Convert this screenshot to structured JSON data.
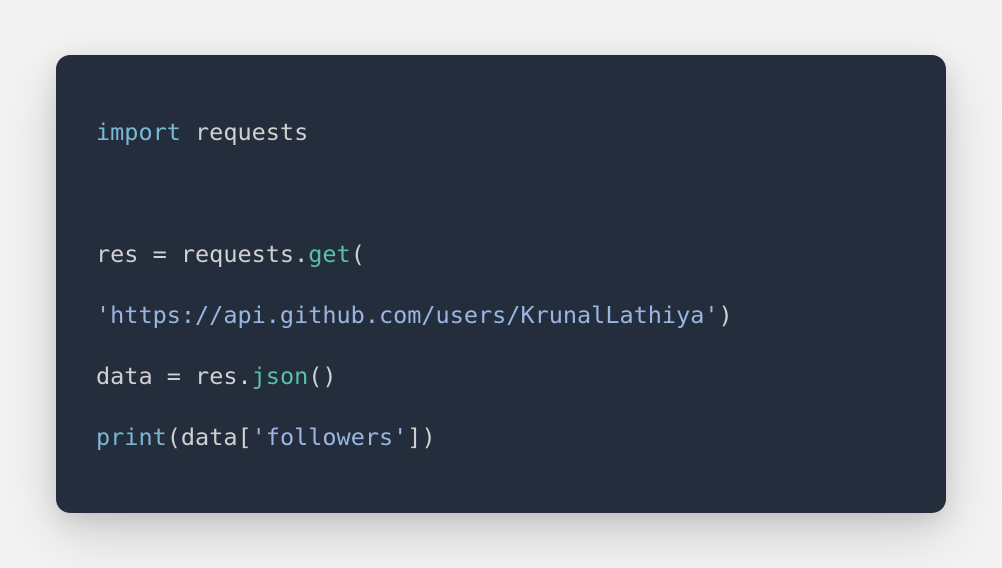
{
  "code": {
    "tokens": [
      [
        {
          "cls": "tok-keyword",
          "t": "import"
        },
        {
          "cls": "tok-default",
          "t": " requests"
        }
      ],
      [],
      [
        {
          "cls": "tok-default",
          "t": "res "
        },
        {
          "cls": "tok-punct",
          "t": "= "
        },
        {
          "cls": "tok-default",
          "t": "requests"
        },
        {
          "cls": "tok-punct",
          "t": "."
        },
        {
          "cls": "tok-method",
          "t": "get"
        },
        {
          "cls": "tok-punct",
          "t": "("
        }
      ],
      [
        {
          "cls": "tok-string",
          "t": "'https://api.github.com/users/KrunalLathiya'"
        },
        {
          "cls": "tok-punct",
          "t": ")"
        }
      ],
      [
        {
          "cls": "tok-default",
          "t": "data "
        },
        {
          "cls": "tok-punct",
          "t": "= "
        },
        {
          "cls": "tok-default",
          "t": "res"
        },
        {
          "cls": "tok-punct",
          "t": "."
        },
        {
          "cls": "tok-method",
          "t": "json"
        },
        {
          "cls": "tok-punct",
          "t": "()"
        }
      ],
      [
        {
          "cls": "tok-builtin",
          "t": "print"
        },
        {
          "cls": "tok-punct",
          "t": "("
        },
        {
          "cls": "tok-default",
          "t": "data"
        },
        {
          "cls": "tok-punct",
          "t": "["
        },
        {
          "cls": "tok-string",
          "t": "'followers'"
        },
        {
          "cls": "tok-punct",
          "t": "])"
        }
      ]
    ]
  }
}
